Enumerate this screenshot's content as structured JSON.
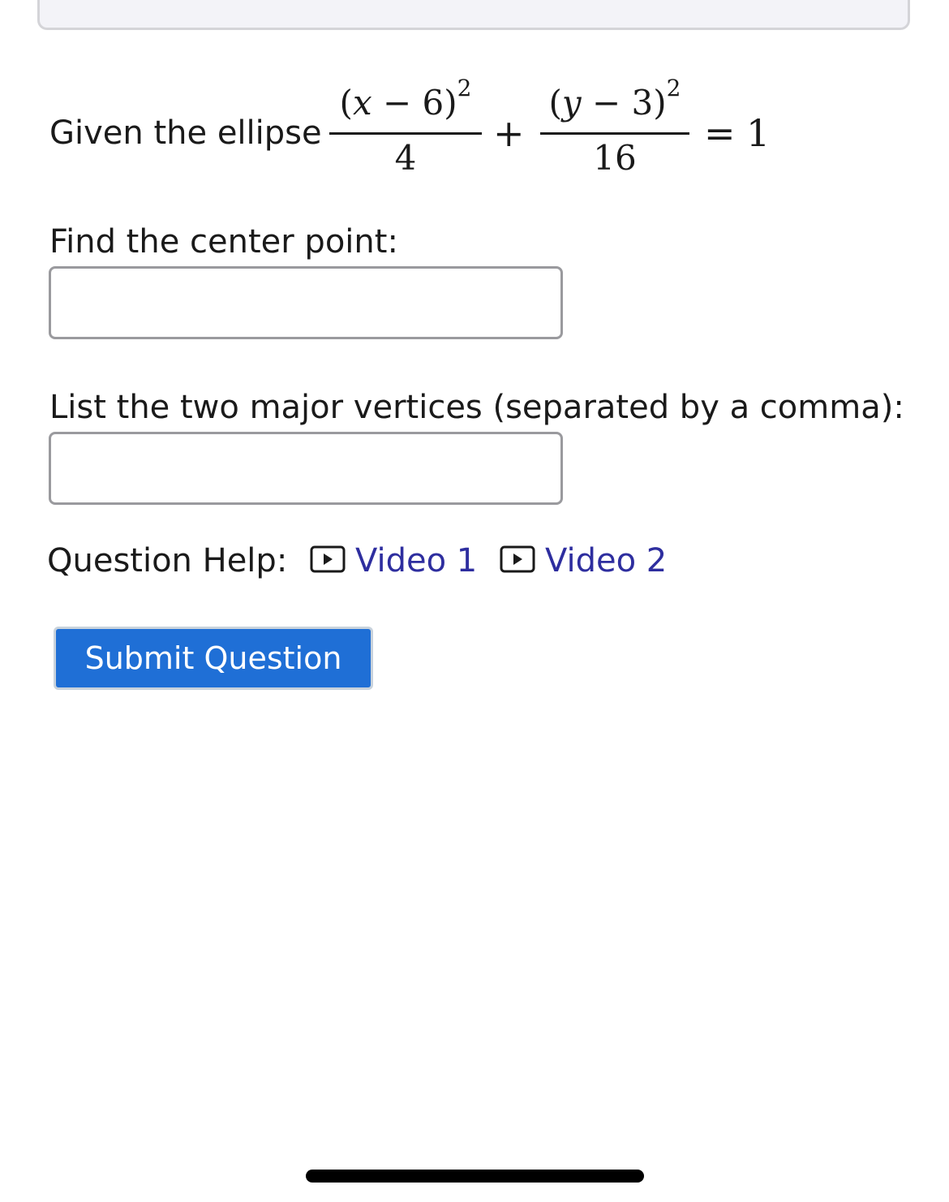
{
  "question": {
    "prompt": "Given the ellipse",
    "equation": {
      "term1_numerator_var": "x",
      "term1_numerator_rest": " − 6)",
      "term1_exponent": "2",
      "term1_denominator": "4",
      "plus": "+",
      "term2_numerator_var": "y",
      "term2_numerator_rest": " − 3)",
      "term2_exponent": "2",
      "term2_denominator": "16",
      "equals": "=",
      "rhs": "1"
    },
    "center_label": "Find the center point:",
    "center_value": "",
    "vertices_label": "List the two major vertices (separated by a comma):",
    "vertices_value": ""
  },
  "help": {
    "label": "Question Help:",
    "links": [
      {
        "label": "Video 1",
        "icon": "play-icon"
      },
      {
        "label": "Video 2",
        "icon": "play-icon"
      }
    ],
    "link_color": "#2e2e9f"
  },
  "submit": {
    "label": "Submit Question",
    "color": "#1f6fd6"
  }
}
